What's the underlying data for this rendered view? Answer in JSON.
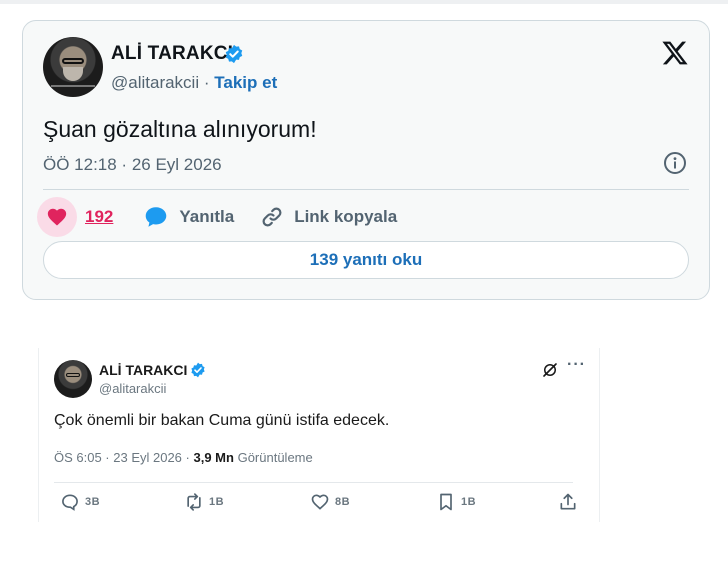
{
  "tweet_embed": {
    "author_name": "ALİ TARAKCI",
    "handle": "@alitarakcii",
    "separator": "·",
    "follow_label": "Takip et",
    "text": "Şuan gözaltına alınıyorum!",
    "timestamp": "ÖÖ 12:18 · 26 Eyl 2026",
    "like_count": "192",
    "reply_label": "Yanıtla",
    "copy_link_label": "Link kopyala",
    "read_replies_label": "139 yanıtı oku",
    "icons": {
      "verified": "verified-badge-icon",
      "logo": "x-logo-icon",
      "info": "info-icon",
      "like": "heart-icon",
      "reply": "reply-bubble-icon",
      "link": "link-icon"
    },
    "colors": {
      "accent": "#1d6fb8",
      "like": "#e0245e",
      "verified": "#1d9bf0"
    }
  },
  "tweet_screenshot": {
    "author_name": "ALİ TARAKCI",
    "handle": "@alitarakcii",
    "text": "Çok önemli bir bakan Cuma günü istifa edecek.",
    "time": "ÖS 6:05 · 23 Eyl 2026 ·",
    "views_count": "3,9 Mn",
    "views_label": "Görüntüleme",
    "more_label": "···",
    "actions": {
      "replies": "3B",
      "retweets": "1B",
      "likes": "8B",
      "bookmarks": "1B"
    }
  }
}
